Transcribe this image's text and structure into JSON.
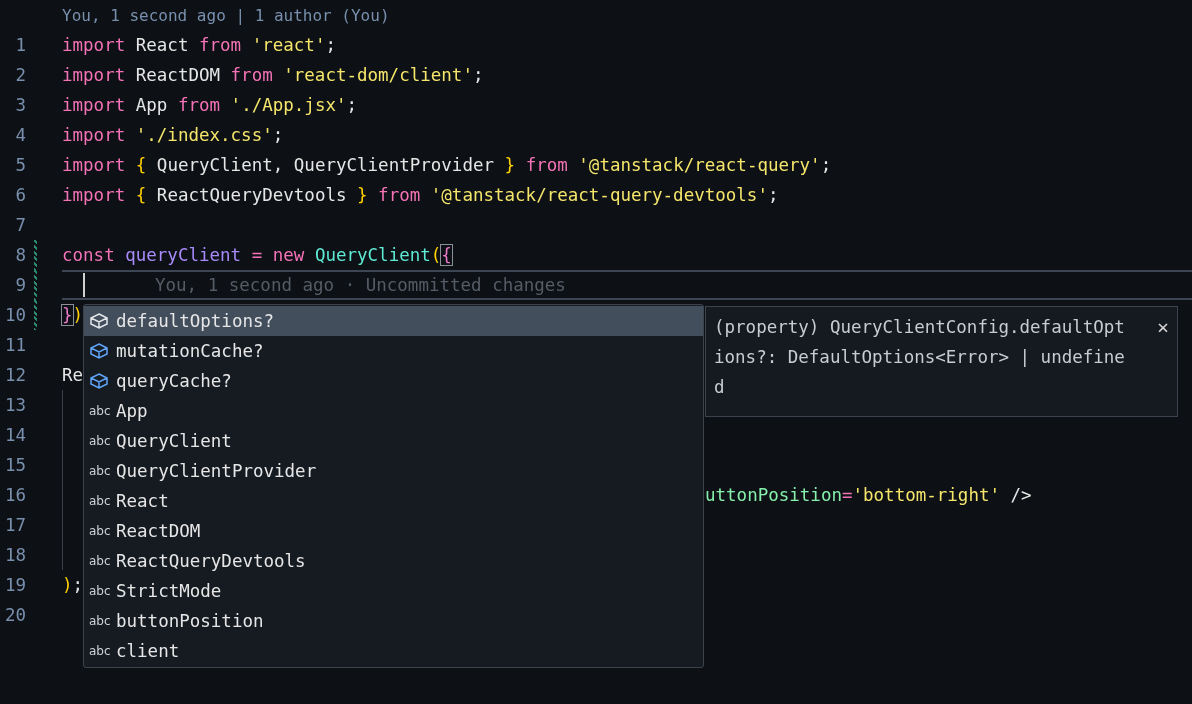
{
  "blame_header": "You, 1 second ago | 1 author (You)",
  "lines": [
    {
      "number": "1",
      "changed": false,
      "current": false,
      "guide": false,
      "after_popup": false,
      "tokens": [
        {
          "kind": "keyword",
          "text": "import"
        },
        {
          "kind": "plain",
          "text": " React "
        },
        {
          "kind": "keyword",
          "text": "from "
        },
        {
          "kind": "string",
          "text": "'react'"
        },
        {
          "kind": "plain",
          "text": ";"
        }
      ]
    },
    {
      "number": "2",
      "changed": false,
      "current": false,
      "guide": false,
      "after_popup": false,
      "tokens": [
        {
          "kind": "keyword",
          "text": "import"
        },
        {
          "kind": "plain",
          "text": " ReactDOM "
        },
        {
          "kind": "keyword",
          "text": "from "
        },
        {
          "kind": "string",
          "text": "'react-dom/client'"
        },
        {
          "kind": "plain",
          "text": ";"
        }
      ]
    },
    {
      "number": "3",
      "changed": false,
      "current": false,
      "guide": false,
      "after_popup": false,
      "tokens": [
        {
          "kind": "keyword",
          "text": "import"
        },
        {
          "kind": "plain",
          "text": " App "
        },
        {
          "kind": "keyword",
          "text": "from "
        },
        {
          "kind": "string",
          "text": "'./App.jsx'"
        },
        {
          "kind": "plain",
          "text": ";"
        }
      ]
    },
    {
      "number": "4",
      "changed": false,
      "current": false,
      "guide": false,
      "after_popup": false,
      "tokens": [
        {
          "kind": "keyword",
          "text": "import "
        },
        {
          "kind": "string",
          "text": "'./index.css'"
        },
        {
          "kind": "plain",
          "text": ";"
        }
      ]
    },
    {
      "number": "5",
      "changed": false,
      "current": false,
      "guide": false,
      "after_popup": false,
      "tokens": [
        {
          "kind": "keyword",
          "text": "import "
        },
        {
          "kind": "brace",
          "text": "{"
        },
        {
          "kind": "plain",
          "text": " QueryClient, QueryClientProvider "
        },
        {
          "kind": "brace",
          "text": "} "
        },
        {
          "kind": "keyword",
          "text": "from "
        },
        {
          "kind": "string",
          "text": "'@tanstack/react-query'"
        },
        {
          "kind": "plain",
          "text": ";"
        }
      ]
    },
    {
      "number": "6",
      "changed": false,
      "current": false,
      "guide": false,
      "after_popup": false,
      "tokens": [
        {
          "kind": "keyword",
          "text": "import "
        },
        {
          "kind": "brace",
          "text": "{"
        },
        {
          "kind": "plain",
          "text": " ReactQueryDevtools "
        },
        {
          "kind": "brace",
          "text": "} "
        },
        {
          "kind": "keyword",
          "text": "from "
        },
        {
          "kind": "string",
          "text": "'@tanstack/react-query-devtools'"
        },
        {
          "kind": "plain",
          "text": ";"
        }
      ]
    },
    {
      "number": "7",
      "changed": false,
      "current": false,
      "guide": false,
      "after_popup": false
    },
    {
      "number": "8",
      "changed": true,
      "current": false,
      "guide": false,
      "after_popup": false,
      "tokens": [
        {
          "kind": "keyword",
          "text": "const "
        },
        {
          "kind": "variable",
          "text": "queryClient "
        },
        {
          "kind": "keyword",
          "text": "= new "
        },
        {
          "kind": "class",
          "text": "QueryClient"
        },
        {
          "kind": "brace",
          "text": "("
        },
        {
          "kind": "bracket",
          "text": "{"
        }
      ]
    },
    {
      "number": "9",
      "changed": true,
      "current": true,
      "guide": false,
      "after_popup": false,
      "blame": "You, 1 second ago · Uncommitted changes"
    },
    {
      "number": "10",
      "changed": true,
      "current": false,
      "guide": false,
      "after_popup": false,
      "tokens": [
        {
          "kind": "bracket",
          "text": "}"
        },
        {
          "kind": "brace",
          "text": ")"
        }
      ]
    },
    {
      "number": "11",
      "changed": false,
      "current": false,
      "guide": false,
      "after_popup": false
    },
    {
      "number": "12",
      "changed": false,
      "current": false,
      "guide": false,
      "after_popup": false,
      "tokens": [
        {
          "kind": "plain",
          "text": "Re"
        }
      ]
    },
    {
      "number": "13",
      "changed": false,
      "current": false,
      "guide": true,
      "after_popup": false
    },
    {
      "number": "14",
      "changed": false,
      "current": false,
      "guide": true,
      "after_popup": false
    },
    {
      "number": "15",
      "changed": false,
      "current": false,
      "guide": true,
      "after_popup": false
    },
    {
      "number": "16",
      "changed": false,
      "current": false,
      "guide": true,
      "after_popup": true,
      "tokens": [
        {
          "kind": "attr",
          "text": "uttonPosition"
        },
        {
          "kind": "keyword",
          "text": "="
        },
        {
          "kind": "string",
          "text": "'bottom-right'"
        },
        {
          "kind": "plain",
          "text": " />"
        }
      ]
    },
    {
      "number": "17",
      "changed": false,
      "current": false,
      "guide": true,
      "after_popup": false
    },
    {
      "number": "18",
      "changed": false,
      "current": false,
      "guide": true,
      "after_popup": false
    },
    {
      "number": "19",
      "changed": false,
      "current": false,
      "guide": false,
      "after_popup": false,
      "tokens": [
        {
          "kind": "brace",
          "text": ")"
        },
        {
          "kind": "plain",
          "text": ";"
        }
      ]
    },
    {
      "number": "20",
      "changed": false,
      "current": false,
      "guide": false,
      "after_popup": false
    }
  ],
  "suggestions": [
    {
      "kind": "property",
      "label": "defaultOptions?",
      "selected": true
    },
    {
      "kind": "property",
      "label": "mutationCache?",
      "selected": false
    },
    {
      "kind": "property",
      "label": "queryCache?",
      "selected": false
    },
    {
      "kind": "word",
      "icon_text": "abc",
      "label": "App",
      "selected": false
    },
    {
      "kind": "word",
      "icon_text": "abc",
      "label": "QueryClient",
      "selected": false
    },
    {
      "kind": "word",
      "icon_text": "abc",
      "label": "QueryClientProvider",
      "selected": false
    },
    {
      "kind": "word",
      "icon_text": "abc",
      "label": "React",
      "selected": false
    },
    {
      "kind": "word",
      "icon_text": "abc",
      "label": "ReactDOM",
      "selected": false
    },
    {
      "kind": "word",
      "icon_text": "abc",
      "label": "ReactQueryDevtools",
      "selected": false
    },
    {
      "kind": "word",
      "icon_text": "abc",
      "label": "StrictMode",
      "selected": false
    },
    {
      "kind": "word",
      "icon_text": "abc",
      "label": "buttonPosition",
      "selected": false
    },
    {
      "kind": "word",
      "icon_text": "abc",
      "label": "client",
      "selected": false
    }
  ],
  "details": {
    "text": "(property) QueryClientConfig.defaultOptions?: DefaultOptions<Error> | undefined",
    "close": "×"
  }
}
